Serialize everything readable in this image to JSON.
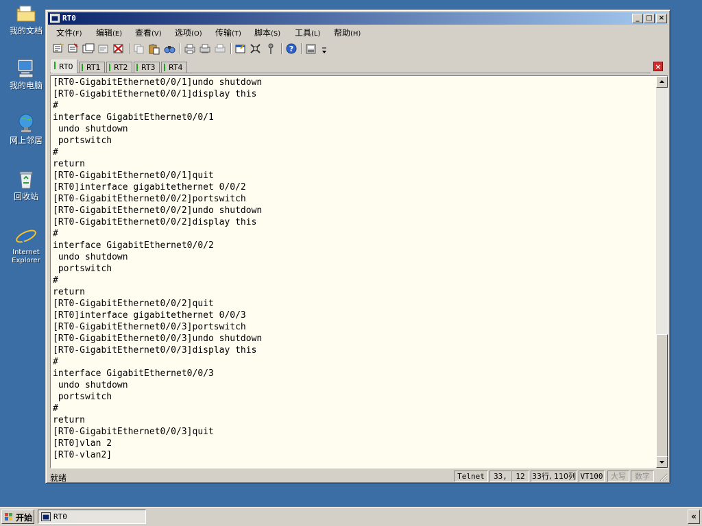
{
  "desktop": {
    "icons": [
      {
        "label": "我的文档",
        "icon": "folder-icon"
      },
      {
        "label": "我的电脑",
        "icon": "computer-icon"
      },
      {
        "label": "网上邻居",
        "icon": "network-icon"
      },
      {
        "label": "回收站",
        "icon": "recycle-bin-icon"
      },
      {
        "label": "Internet Explorer",
        "icon": "ie-icon"
      }
    ]
  },
  "window": {
    "title": "RT0",
    "controls": {
      "minimize": "_",
      "maximize": "□",
      "close": "×"
    }
  },
  "menu": {
    "items": [
      {
        "label": "文件",
        "accel": "(F)"
      },
      {
        "label": "编辑",
        "accel": "(E)"
      },
      {
        "label": "查看",
        "accel": "(V)"
      },
      {
        "label": "选项",
        "accel": "(O)"
      },
      {
        "label": "传输",
        "accel": "(T)"
      },
      {
        "label": "脚本",
        "accel": "(S)"
      },
      {
        "label": "工具",
        "accel": "(L)"
      },
      {
        "label": "帮助",
        "accel": "(H)"
      }
    ]
  },
  "toolbar": {
    "icons": [
      "new-session-icon",
      "connect-icon",
      "open-icon",
      "reconnect-icon",
      "disconnect-icon",
      "copy-icon",
      "paste-icon",
      "find-icon",
      "print-icon",
      "print-setup-icon",
      "print-selection-icon",
      "session-options-icon",
      "global-options-icon",
      "keymap-icon",
      "help-icon",
      "sftp-icon",
      "toolbar-more-icon"
    ]
  },
  "tabs": [
    {
      "label": "RT0",
      "active": true
    },
    {
      "label": "RT1",
      "active": false
    },
    {
      "label": "RT2",
      "active": false
    },
    {
      "label": "RT3",
      "active": false
    },
    {
      "label": "RT4",
      "active": false
    }
  ],
  "terminal": {
    "lines": [
      "[RT0-GigabitEthernet0/0/1]undo shutdown",
      "[RT0-GigabitEthernet0/0/1]display this",
      "#",
      "interface GigabitEthernet0/0/1",
      " undo shutdown",
      " portswitch",
      "#",
      "return",
      "[RT0-GigabitEthernet0/0/1]quit",
      "[RT0]interface gigabitethernet 0/0/2",
      "[RT0-GigabitEthernet0/0/2]portswitch",
      "[RT0-GigabitEthernet0/0/2]undo shutdown",
      "[RT0-GigabitEthernet0/0/2]display this",
      "#",
      "interface GigabitEthernet0/0/2",
      " undo shutdown",
      " portswitch",
      "#",
      "return",
      "[RT0-GigabitEthernet0/0/2]quit",
      "[RT0]interface gigabitethernet 0/0/3",
      "[RT0-GigabitEthernet0/0/3]portswitch",
      "[RT0-GigabitEthernet0/0/3]undo shutdown",
      "[RT0-GigabitEthernet0/0/3]display this",
      "#",
      "interface GigabitEthernet0/0/3",
      " undo shutdown",
      " portswitch",
      "#",
      "return",
      "[RT0-GigabitEthernet0/0/3]quit",
      "[RT0]vlan 2",
      "[RT0-vlan2]"
    ]
  },
  "status": {
    "left": "就绪",
    "protocol": "Telnet",
    "cursor_row": "33,",
    "cursor_col": "12",
    "size": "33行, 110列",
    "emulation": "VT100",
    "caps": "大写",
    "num": "数字"
  },
  "taskbar": {
    "start_label": "开始",
    "task_label": "RT0",
    "tray_button": "«"
  },
  "colors": {
    "desktop": "#3a6ea5",
    "titlebar_start": "#0a246a",
    "titlebar_end": "#a6caf0",
    "terminal_bg": "#fffdf0",
    "tab_led": "#1aa51a",
    "tab_close": "#d42b2b"
  }
}
